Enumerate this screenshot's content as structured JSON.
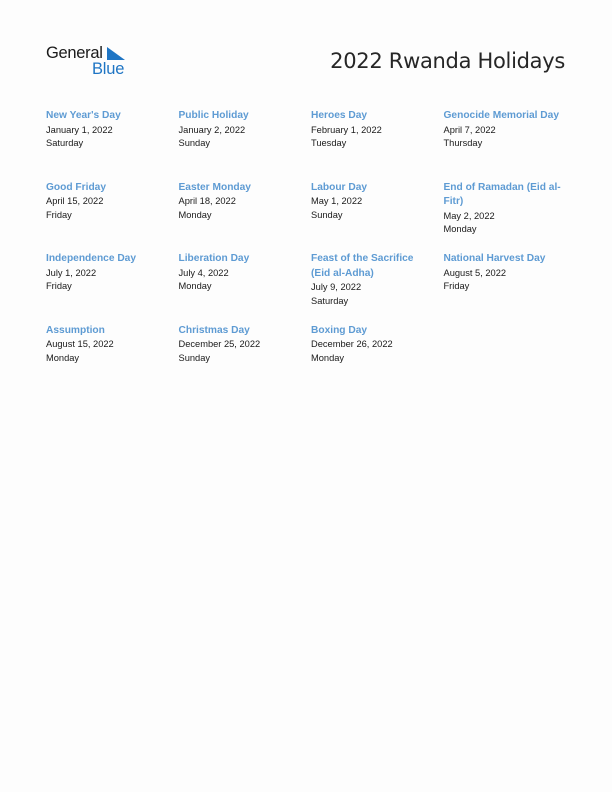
{
  "logo": {
    "line1": "General",
    "line2": "Blue"
  },
  "title": "2022 Rwanda Holidays",
  "colors": {
    "holiday_name": "#5e9bd3",
    "logo_blue": "#1f75c4",
    "text": "#1a1a1a"
  },
  "holidays": [
    {
      "name": "New Year's Day",
      "date": "January 1, 2022",
      "day": "Saturday"
    },
    {
      "name": "Public Holiday",
      "date": "January 2, 2022",
      "day": "Sunday"
    },
    {
      "name": "Heroes Day",
      "date": "February 1, 2022",
      "day": "Tuesday"
    },
    {
      "name": "Genocide Memorial Day",
      "date": "April 7, 2022",
      "day": "Thursday"
    },
    {
      "name": "Good Friday",
      "date": "April 15, 2022",
      "day": "Friday"
    },
    {
      "name": "Easter Monday",
      "date": "April 18, 2022",
      "day": "Monday"
    },
    {
      "name": "Labour Day",
      "date": "May 1, 2022",
      "day": "Sunday"
    },
    {
      "name": "End of Ramadan (Eid al-Fitr)",
      "date": "May 2, 2022",
      "day": "Monday"
    },
    {
      "name": "Independence Day",
      "date": "July 1, 2022",
      "day": "Friday"
    },
    {
      "name": "Liberation Day",
      "date": "July 4, 2022",
      "day": "Monday"
    },
    {
      "name": "Feast of the Sacrifice (Eid al-Adha)",
      "date": "July 9, 2022",
      "day": "Saturday"
    },
    {
      "name": "National Harvest Day",
      "date": "August 5, 2022",
      "day": "Friday"
    },
    {
      "name": "Assumption",
      "date": "August 15, 2022",
      "day": "Monday"
    },
    {
      "name": "Christmas Day",
      "date": "December 25, 2022",
      "day": "Sunday"
    },
    {
      "name": "Boxing Day",
      "date": "December 26, 2022",
      "day": "Monday"
    }
  ]
}
